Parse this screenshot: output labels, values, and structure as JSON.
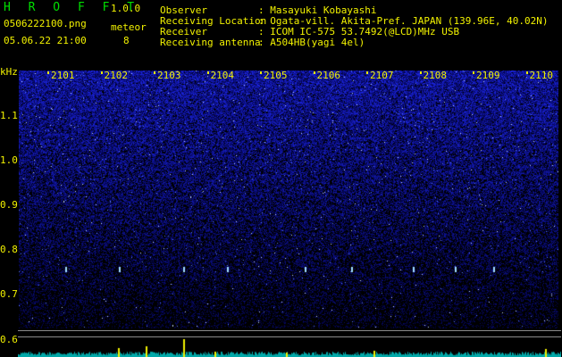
{
  "header": {
    "app_name": "H R O F F T",
    "version": "1.0.0",
    "filename": "0506222100.png",
    "datetime": "05.06.22 21:00",
    "mode_label": "meteor",
    "count": "8"
  },
  "station": {
    "observer_label": "Observer",
    "observer_value": ": Masayuki Kobayashi",
    "location_label": "Receiving Location",
    "location_value": ": Ogata-vill. Akita-Pref. JAPAN (139.96E, 40.02N)",
    "receiver_label": "Receiver",
    "receiver_value": ": ICOM IC-575 53.7492(@LCD)MHz USB",
    "antenna_label": "Receiving antenna",
    "antenna_value": ": A504HB(yagi 4el)"
  },
  "time_axis": {
    "labels": [
      "2101",
      "2102",
      "2103",
      "2104",
      "2105",
      "2106",
      "2107",
      "2108",
      "2109",
      "2110"
    ]
  },
  "freq_axis": {
    "unit": "kHz",
    "labels": [
      "1.1",
      "1.0",
      "0.9",
      "0.8",
      "0.7",
      "0.6"
    ]
  },
  "colors": {
    "text": "#f2f200",
    "title": "#00e000",
    "spectrum_low": "#000010",
    "spectrum_high": "#2a3cff",
    "baseline": "#00e0e0"
  }
}
